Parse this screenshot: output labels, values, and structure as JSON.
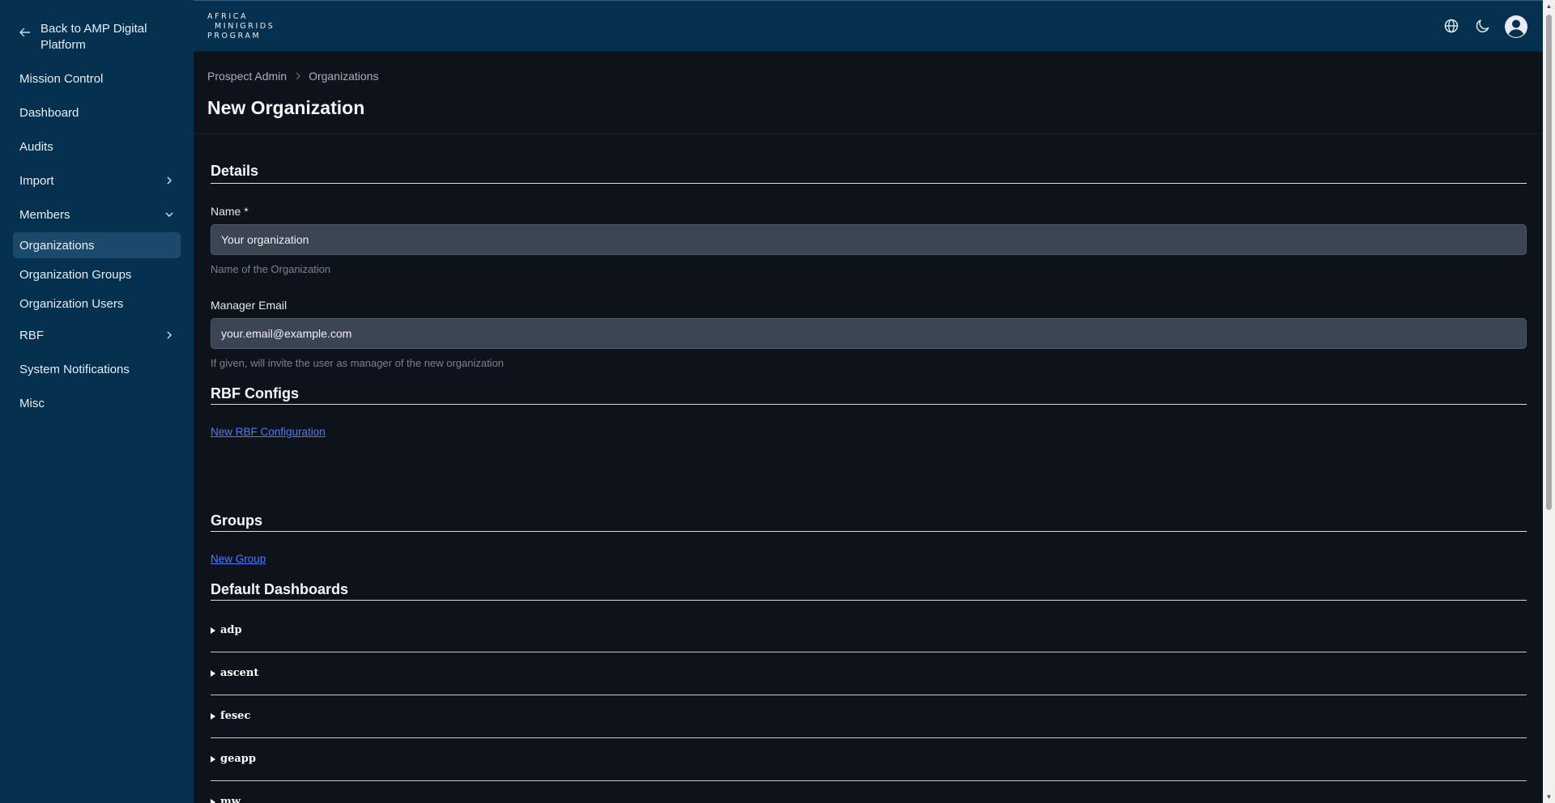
{
  "sidebar": {
    "back_label": "Back to AMP Digital Platform",
    "items": [
      {
        "label": "Mission Control"
      },
      {
        "label": "Dashboard"
      },
      {
        "label": "Audits"
      },
      {
        "label": "Import"
      },
      {
        "label": "Members"
      },
      {
        "label": "Organizations"
      },
      {
        "label": "Organization Groups"
      },
      {
        "label": "Organization Users"
      },
      {
        "label": "RBF"
      },
      {
        "label": "System Notifications"
      },
      {
        "label": "Misc"
      }
    ]
  },
  "header": {
    "logo_line1": "AFRICA",
    "logo_line2": "MINIGRIDS",
    "logo_line3": "PROGRAM",
    "icons": [
      "globe-icon",
      "moon-icon",
      "account-icon"
    ]
  },
  "breadcrumb": {
    "root": "Prospect Admin",
    "current": "Organizations"
  },
  "page": {
    "title": "New Organization"
  },
  "form": {
    "details_title": "Details",
    "name_label": "Name *",
    "name_placeholder": "Your organization",
    "name_help": "Name of the Organization",
    "email_label": "Manager Email",
    "email_placeholder": "your.email@example.com",
    "email_help": "If given, will invite the user as manager of the new organization",
    "rbf_title": "RBF Configs",
    "rbf_link": "New RBF Configuration",
    "groups_title": "Groups",
    "groups_link": "New Group",
    "dashboards_title": "Default Dashboards",
    "dashboards": [
      {
        "label": "adp"
      },
      {
        "label": "ascent"
      },
      {
        "label": "fesec"
      },
      {
        "label": "geapp"
      },
      {
        "label": "mw"
      }
    ]
  },
  "colors": {
    "sidebar_bg": "#05304f",
    "page_bg": "#0e121b",
    "active_item": "#1b4a6d",
    "link": "#4d7cff"
  }
}
